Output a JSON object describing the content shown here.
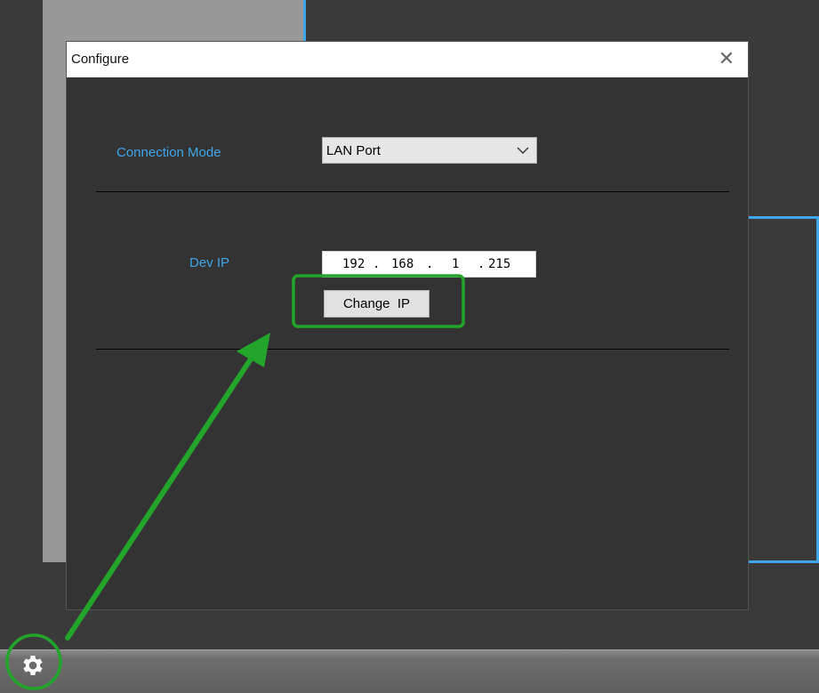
{
  "dialog": {
    "title": "Configure",
    "close_glyph": "✕",
    "connection_mode": {
      "label": "Connection Mode",
      "selected": "LAN Port"
    },
    "dev_ip": {
      "label": "Dev IP",
      "octets": [
        "192",
        "168",
        "1",
        "215"
      ]
    },
    "change_ip_button": "Change  IP"
  },
  "taskbar": {
    "settings_icon": "gear-icon"
  },
  "colors": {
    "accent_blue": "#3fa6ea",
    "annotation_green": "#22a52a",
    "dialog_bg": "#333333"
  }
}
